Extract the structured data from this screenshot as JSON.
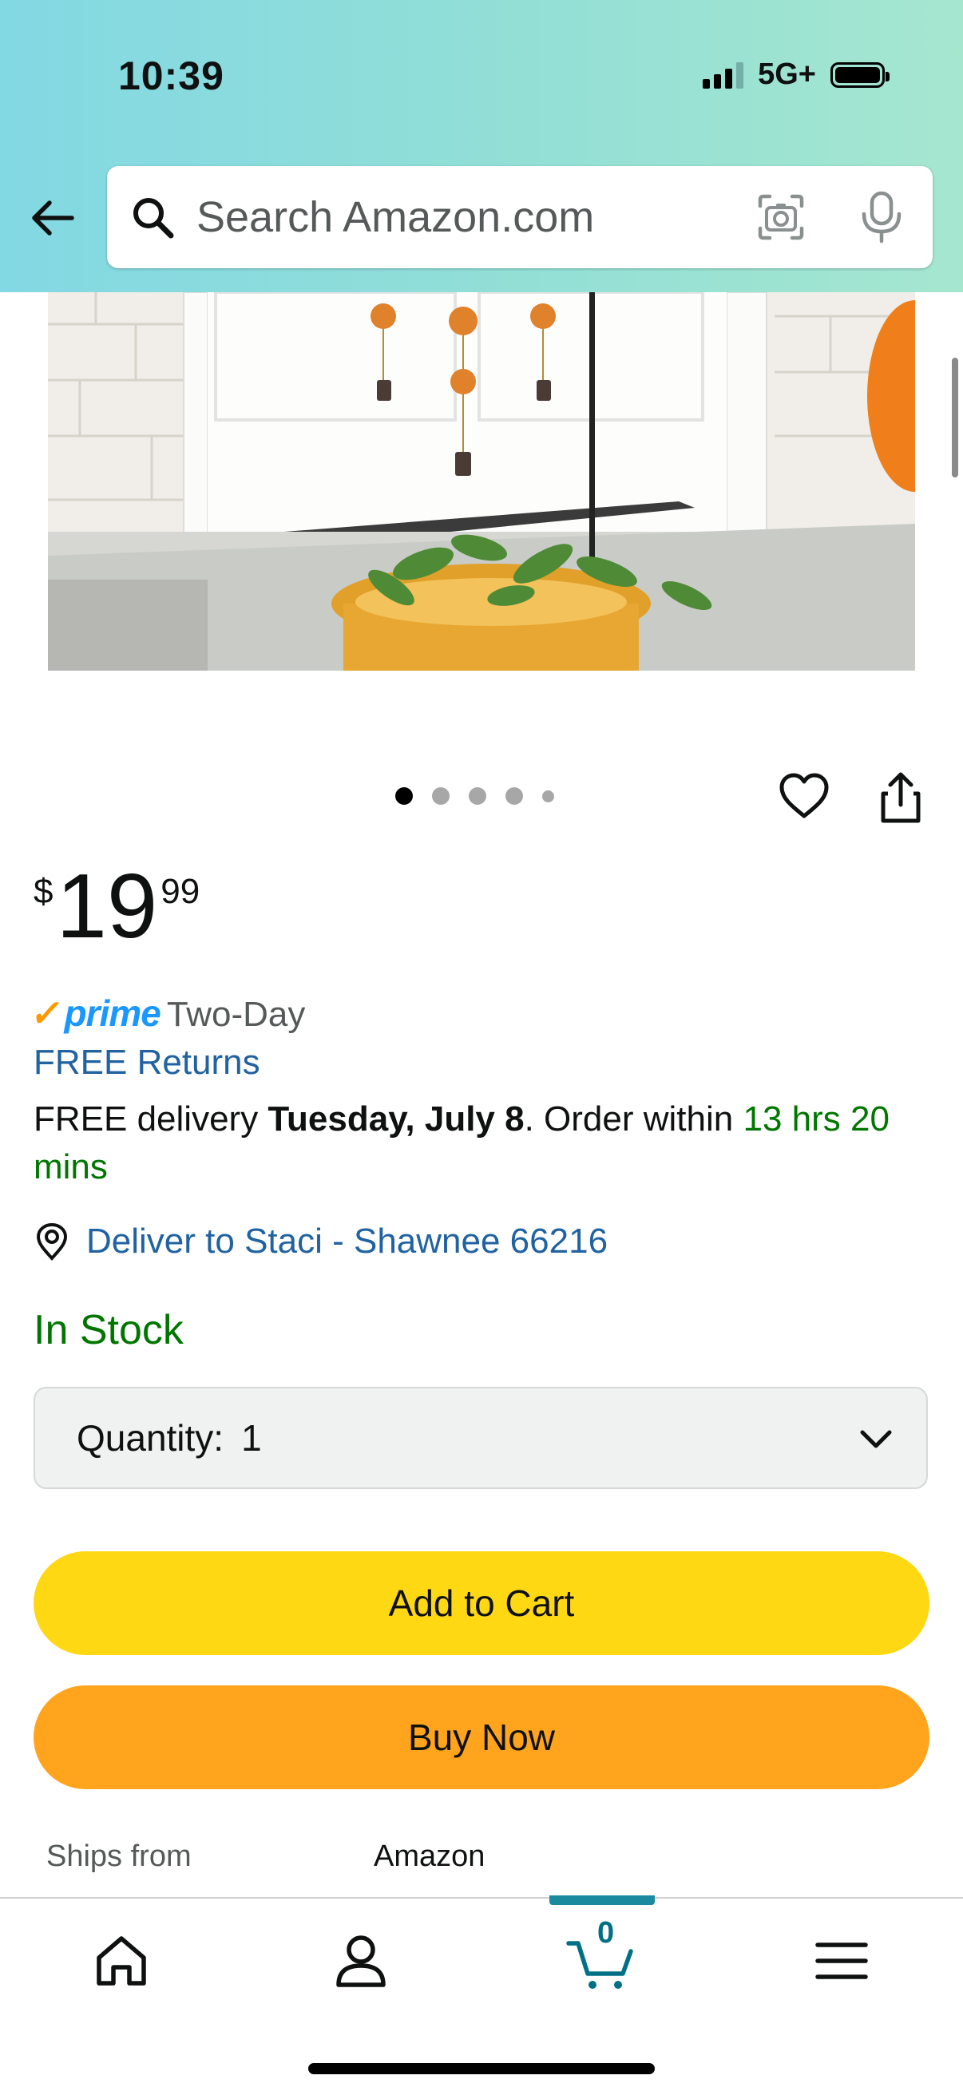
{
  "status_bar": {
    "time": "10:39",
    "network": "5G+"
  },
  "search": {
    "placeholder": "Search Amazon.com"
  },
  "gallery": {
    "dot_count": 5,
    "active_dot": 0
  },
  "price": {
    "currency": "$",
    "whole": "19",
    "fraction": "99"
  },
  "prime": {
    "check": "✓",
    "word": "prime",
    "speed": "Two-Day"
  },
  "returns": {
    "label": "FREE Returns"
  },
  "delivery": {
    "prefix": "FREE delivery ",
    "date": "Tuesday, July 8",
    "middle": ". Order within ",
    "countdown": "13 hrs 20 mins"
  },
  "deliver_to": {
    "label": "Deliver to Staci - Shawnee 66216"
  },
  "stock": {
    "label": "In Stock"
  },
  "quantity": {
    "label": "Quantity:",
    "value": "1"
  },
  "buttons": {
    "add_to_cart": "Add to Cart",
    "buy_now": "Buy Now"
  },
  "ships_from": {
    "label": "Ships from",
    "value": "Amazon"
  },
  "bottom_nav": {
    "cart_count": "0"
  },
  "colors": {
    "add_to_cart": "#ffd814",
    "buy_now": "#ffa41c",
    "link": "#2162a1",
    "in_stock": "#007600",
    "prime_blue": "#1a98ff",
    "prime_check": "#ff9900"
  }
}
